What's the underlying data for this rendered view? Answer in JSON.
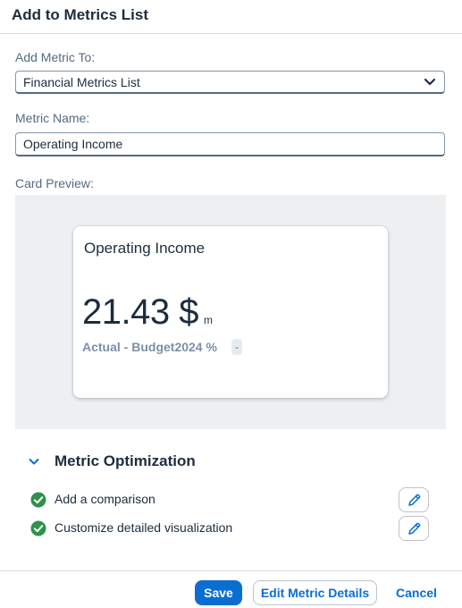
{
  "dialog": {
    "title": "Add to Metrics List"
  },
  "form": {
    "add_metric_to_label": "Add Metric To:",
    "add_metric_to_value": "Financial Metrics List",
    "metric_name_label": "Metric Name:",
    "metric_name_value": "Operating Income",
    "card_preview_label": "Card Preview:"
  },
  "card": {
    "title": "Operating Income",
    "value": "21.43 $",
    "scale": "m",
    "subtitle": "Actual - Budget2024 %",
    "delta": "-"
  },
  "optimization": {
    "title": "Metric Optimization",
    "items": [
      {
        "label": "Add a comparison",
        "status_icon": "check-circle-icon",
        "action_icon": "edit-icon"
      },
      {
        "label": "Customize detailed visualization",
        "status_icon": "check-circle-icon",
        "action_icon": "edit-icon"
      }
    ]
  },
  "footer": {
    "save_label": "Save",
    "edit_details_label": "Edit Metric Details",
    "cancel_label": "Cancel"
  },
  "colors": {
    "accent": "#0a6ed1",
    "success": "#30914c",
    "text": "#1d2d3e",
    "preview_bg": "#eeeff1"
  }
}
